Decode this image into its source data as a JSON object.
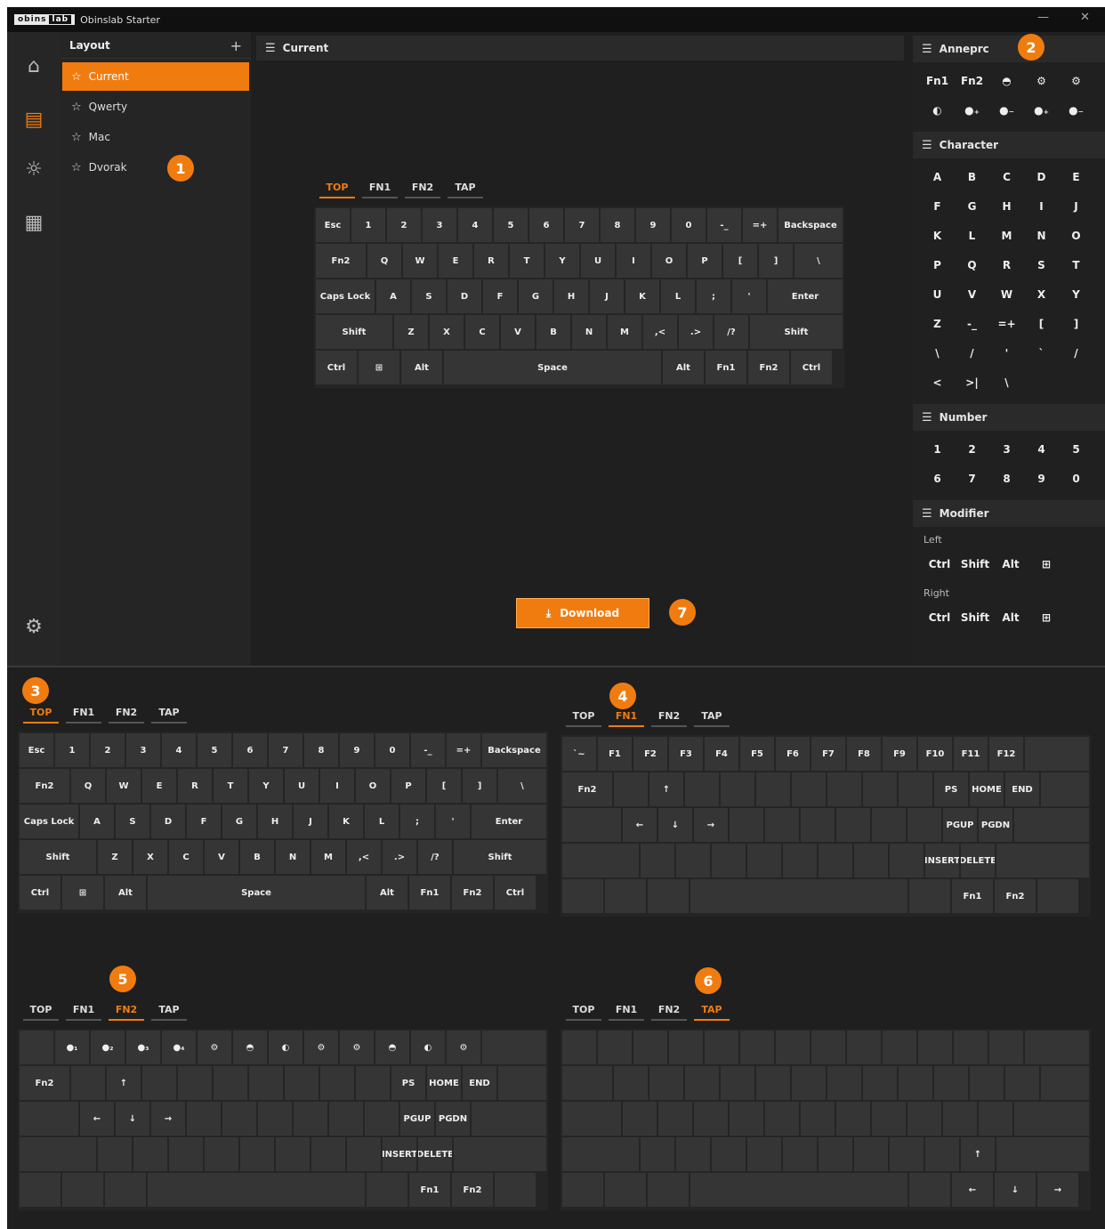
{
  "app": {
    "logo": "obins",
    "logo_mark": "lab",
    "title": "Obinslab Starter",
    "minimize": "—",
    "close": "✕"
  },
  "rail": [
    {
      "icon": "home-icon",
      "glyph": "⌂"
    },
    {
      "icon": "keyboard-icon",
      "glyph": "▤"
    },
    {
      "icon": "light-icon",
      "glyph": "☼"
    },
    {
      "icon": "macro-icon",
      "glyph": "▦"
    },
    {
      "icon": "settings-icon",
      "glyph": "⚙"
    }
  ],
  "layout": {
    "title": "Layout",
    "add": "+",
    "items": [
      "Current",
      "Qwerty",
      "Mac",
      "Dvorak"
    ],
    "active": 0
  },
  "center": {
    "title": "Current",
    "download": "Download",
    "download_icon": "⤓"
  },
  "sections": [
    {
      "title": "Anneprc",
      "glyphs": [
        "Fn1",
        "Fn2",
        "◓",
        "⚙",
        "⚙",
        "◐",
        "●₊",
        "●₋",
        "●₊",
        "●₋"
      ]
    },
    {
      "title": "Character",
      "glyphs": [
        "A",
        "B",
        "C",
        "D",
        "E",
        "F",
        "G",
        "H",
        "I",
        "J",
        "K",
        "L",
        "M",
        "N",
        "O",
        "P",
        "Q",
        "R",
        "S",
        "T",
        "U",
        "V",
        "W",
        "X",
        "Y",
        "Z",
        "-_",
        "=+",
        "[",
        "]",
        "\\",
        "/",
        "'",
        "`",
        "/",
        "<",
        ">|",
        "\\"
      ]
    },
    {
      "title": "Number",
      "glyphs": [
        "1",
        "2",
        "3",
        "4",
        "5",
        "6",
        "7",
        "8",
        "9",
        "0"
      ]
    },
    {
      "title": "Modifier",
      "left_label": "Left",
      "right_label": "Right",
      "mods": [
        "Ctrl",
        "Shift",
        "Alt",
        "⊞"
      ],
      "right_mods": [
        "Ctrl",
        "Shift",
        "Alt",
        "⊞"
      ]
    }
  ],
  "tabs": [
    "TOP",
    "FN1",
    "FN2",
    "TAP"
  ],
  "badges": [
    "1",
    "2",
    "3",
    "4",
    "5",
    "6",
    "7"
  ],
  "kb_top": [
    [
      [
        "Esc",
        38
      ],
      [
        "1",
        38
      ],
      [
        "2",
        38
      ],
      [
        "3",
        38
      ],
      [
        "4",
        38
      ],
      [
        "5",
        38
      ],
      [
        "6",
        38
      ],
      [
        "7",
        38
      ],
      [
        "8",
        38
      ],
      [
        "9",
        38
      ],
      [
        "0",
        38
      ],
      [
        "-_",
        38
      ],
      [
        "=+",
        38
      ],
      [
        "Backspace",
        72
      ]
    ],
    [
      [
        "Fn2",
        56
      ],
      [
        "Q",
        38
      ],
      [
        "W",
        38
      ],
      [
        "E",
        38
      ],
      [
        "R",
        38
      ],
      [
        "T",
        38
      ],
      [
        "Y",
        38
      ],
      [
        "U",
        38
      ],
      [
        "I",
        38
      ],
      [
        "O",
        38
      ],
      [
        "P",
        38
      ],
      [
        "[",
        38
      ],
      [
        "]",
        38
      ],
      [
        "\\",
        54
      ]
    ],
    [
      [
        "Caps Lock",
        66
      ],
      [
        "A",
        38
      ],
      [
        "S",
        38
      ],
      [
        "D",
        38
      ],
      [
        "F",
        38
      ],
      [
        "G",
        38
      ],
      [
        "H",
        38
      ],
      [
        "J",
        38
      ],
      [
        "K",
        38
      ],
      [
        "L",
        38
      ],
      [
        ";",
        38
      ],
      [
        "'",
        38
      ],
      [
        "Enter",
        84
      ]
    ],
    [
      [
        "Shift",
        86
      ],
      [
        "Z",
        38
      ],
      [
        "X",
        38
      ],
      [
        "C",
        38
      ],
      [
        "V",
        38
      ],
      [
        "B",
        38
      ],
      [
        "N",
        38
      ],
      [
        "M",
        38
      ],
      [
        ",<",
        38
      ],
      [
        ".>",
        38
      ],
      [
        "/?",
        38
      ],
      [
        "Shift",
        104
      ]
    ],
    [
      [
        "Ctrl",
        46
      ],
      [
        "⊞",
        46
      ],
      [
        "Alt",
        46
      ],
      [
        "Space",
        244
      ],
      [
        "Alt",
        46
      ],
      [
        "Fn1",
        46
      ],
      [
        "Fn2",
        46
      ],
      [
        "Ctrl",
        46
      ]
    ]
  ],
  "kb_fn1": [
    [
      [
        "`~",
        38
      ],
      [
        "F1",
        38
      ],
      [
        "F2",
        38
      ],
      [
        "F3",
        38
      ],
      [
        "F4",
        38
      ],
      [
        "F5",
        38
      ],
      [
        "F6",
        38
      ],
      [
        "F7",
        38
      ],
      [
        "F8",
        38
      ],
      [
        "F9",
        38
      ],
      [
        "F10",
        38
      ],
      [
        "F11",
        38
      ],
      [
        "F12",
        38
      ],
      [
        "",
        72
      ]
    ],
    [
      [
        "Fn2",
        56
      ],
      [
        "",
        38
      ],
      [
        "↑",
        38
      ],
      [
        "",
        38
      ],
      [
        "",
        38
      ],
      [
        "",
        38
      ],
      [
        "",
        38
      ],
      [
        "",
        38
      ],
      [
        "",
        38
      ],
      [
        "",
        38
      ],
      [
        "PS",
        38
      ],
      [
        "HOME",
        38
      ],
      [
        "END",
        38
      ],
      [
        "",
        54
      ]
    ],
    [
      [
        "",
        66
      ],
      [
        "←",
        38
      ],
      [
        "↓",
        38
      ],
      [
        "→",
        38
      ],
      [
        "",
        38
      ],
      [
        "",
        38
      ],
      [
        "",
        38
      ],
      [
        "",
        38
      ],
      [
        "",
        38
      ],
      [
        "",
        38
      ],
      [
        "PGUP",
        38
      ],
      [
        "PGDN",
        38
      ],
      [
        "",
        84
      ]
    ],
    [
      [
        "",
        86
      ],
      [
        "",
        38
      ],
      [
        "",
        38
      ],
      [
        "",
        38
      ],
      [
        "",
        38
      ],
      [
        "",
        38
      ],
      [
        "",
        38
      ],
      [
        "",
        38
      ],
      [
        "",
        38
      ],
      [
        "INSERT",
        38
      ],
      [
        "DELETE",
        38
      ],
      [
        "",
        104
      ]
    ],
    [
      [
        "",
        46
      ],
      [
        "",
        46
      ],
      [
        "",
        46
      ],
      [
        "",
        244
      ],
      [
        "",
        46
      ],
      [
        "Fn1",
        46
      ],
      [
        "Fn2",
        46
      ],
      [
        "",
        46
      ]
    ]
  ],
  "kb_fn2": [
    [
      [
        "",
        38
      ],
      [
        "●₁",
        38
      ],
      [
        "●₂",
        38
      ],
      [
        "●₃",
        38
      ],
      [
        "●₄",
        38
      ],
      [
        "⚙",
        38
      ],
      [
        "◓",
        38
      ],
      [
        "◐",
        38
      ],
      [
        "⚙",
        38
      ],
      [
        "⚙",
        38
      ],
      [
        "◓",
        38
      ],
      [
        "◐",
        38
      ],
      [
        "⚙",
        38
      ],
      [
        "",
        72
      ]
    ],
    [
      [
        "Fn2",
        56
      ],
      [
        "",
        38
      ],
      [
        "↑",
        38
      ],
      [
        "",
        38
      ],
      [
        "",
        38
      ],
      [
        "",
        38
      ],
      [
        "",
        38
      ],
      [
        "",
        38
      ],
      [
        "",
        38
      ],
      [
        "",
        38
      ],
      [
        "PS",
        38
      ],
      [
        "HOME",
        38
      ],
      [
        "END",
        38
      ],
      [
        "",
        54
      ]
    ],
    [
      [
        "",
        66
      ],
      [
        "←",
        38
      ],
      [
        "↓",
        38
      ],
      [
        "→",
        38
      ],
      [
        "",
        38
      ],
      [
        "",
        38
      ],
      [
        "",
        38
      ],
      [
        "",
        38
      ],
      [
        "",
        38
      ],
      [
        "",
        38
      ],
      [
        "PGUP",
        38
      ],
      [
        "PGDN",
        38
      ],
      [
        "",
        84
      ]
    ],
    [
      [
        "",
        86
      ],
      [
        "",
        38
      ],
      [
        "",
        38
      ],
      [
        "",
        38
      ],
      [
        "",
        38
      ],
      [
        "",
        38
      ],
      [
        "",
        38
      ],
      [
        "",
        38
      ],
      [
        "",
        38
      ],
      [
        "INSERT",
        38
      ],
      [
        "DELETE",
        38
      ],
      [
        "",
        104
      ]
    ],
    [
      [
        "",
        46
      ],
      [
        "",
        46
      ],
      [
        "",
        46
      ],
      [
        "",
        244
      ],
      [
        "",
        46
      ],
      [
        "Fn1",
        46
      ],
      [
        "Fn2",
        46
      ],
      [
        "",
        46
      ]
    ]
  ],
  "kb_tap": [
    [
      [
        "",
        38
      ],
      [
        "",
        38
      ],
      [
        "",
        38
      ],
      [
        "",
        38
      ],
      [
        "",
        38
      ],
      [
        "",
        38
      ],
      [
        "",
        38
      ],
      [
        "",
        38
      ],
      [
        "",
        38
      ],
      [
        "",
        38
      ],
      [
        "",
        38
      ],
      [
        "",
        38
      ],
      [
        "",
        38
      ],
      [
        "",
        72
      ]
    ],
    [
      [
        "",
        56
      ],
      [
        "",
        38
      ],
      [
        "",
        38
      ],
      [
        "",
        38
      ],
      [
        "",
        38
      ],
      [
        "",
        38
      ],
      [
        "",
        38
      ],
      [
        "",
        38
      ],
      [
        "",
        38
      ],
      [
        "",
        38
      ],
      [
        "",
        38
      ],
      [
        "",
        38
      ],
      [
        "",
        38
      ],
      [
        "",
        54
      ]
    ],
    [
      [
        "",
        66
      ],
      [
        "",
        38
      ],
      [
        "",
        38
      ],
      [
        "",
        38
      ],
      [
        "",
        38
      ],
      [
        "",
        38
      ],
      [
        "",
        38
      ],
      [
        "",
        38
      ],
      [
        "",
        38
      ],
      [
        "",
        38
      ],
      [
        "",
        38
      ],
      [
        "",
        38
      ],
      [
        "",
        84
      ]
    ],
    [
      [
        "",
        86
      ],
      [
        "",
        38
      ],
      [
        "",
        38
      ],
      [
        "",
        38
      ],
      [
        "",
        38
      ],
      [
        "",
        38
      ],
      [
        "",
        38
      ],
      [
        "",
        38
      ],
      [
        "",
        38
      ],
      [
        "",
        38
      ],
      [
        "↑",
        38
      ],
      [
        "",
        104
      ]
    ],
    [
      [
        "",
        46
      ],
      [
        "",
        46
      ],
      [
        "",
        46
      ],
      [
        "",
        244
      ],
      [
        "",
        46
      ],
      [
        "←",
        46
      ],
      [
        "↓",
        46
      ],
      [
        "→",
        46
      ]
    ]
  ]
}
